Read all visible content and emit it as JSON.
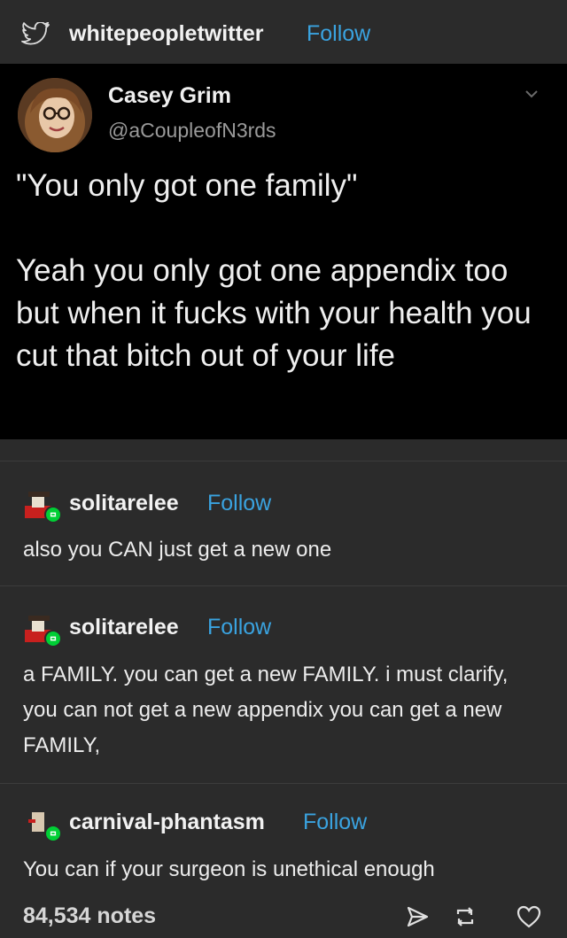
{
  "header": {
    "blog_name": "whitepeopletwitter",
    "follow_label": "Follow"
  },
  "tweet": {
    "display_name": "Casey Grim",
    "handle": "@aCoupleofN3rds",
    "line1": "\"You only got one family\"",
    "line2": "Yeah you only got one appendix too but when it fucks with your health you cut that bitch out of your life"
  },
  "reblogs": [
    {
      "user": "solitarelee",
      "follow": "Follow",
      "text": "also you CAN just get a new one"
    },
    {
      "user": "solitarelee",
      "follow": "Follow",
      "text": "a FAMILY. you can get a new FAMILY. i must clarify, you can not get a new appendix you can get a new FAMILY,"
    },
    {
      "user": "carnival-phantasm",
      "follow": "Follow",
      "text": "You can if your surgeon is unethical enough"
    }
  ],
  "footer": {
    "notes": "84,534 notes"
  },
  "icons": {
    "header": "twitter-bird-icon",
    "chevron": "chevron-down-icon",
    "reblog_badge": "reblog-badge-icon",
    "share": "share-icon",
    "reblog": "reblog-icon",
    "like": "heart-icon"
  },
  "colors": {
    "background": "#2b2b2b",
    "tweet_background": "#000000",
    "follow": "#3aa3e0",
    "reblog_badge": "#00cf35"
  }
}
